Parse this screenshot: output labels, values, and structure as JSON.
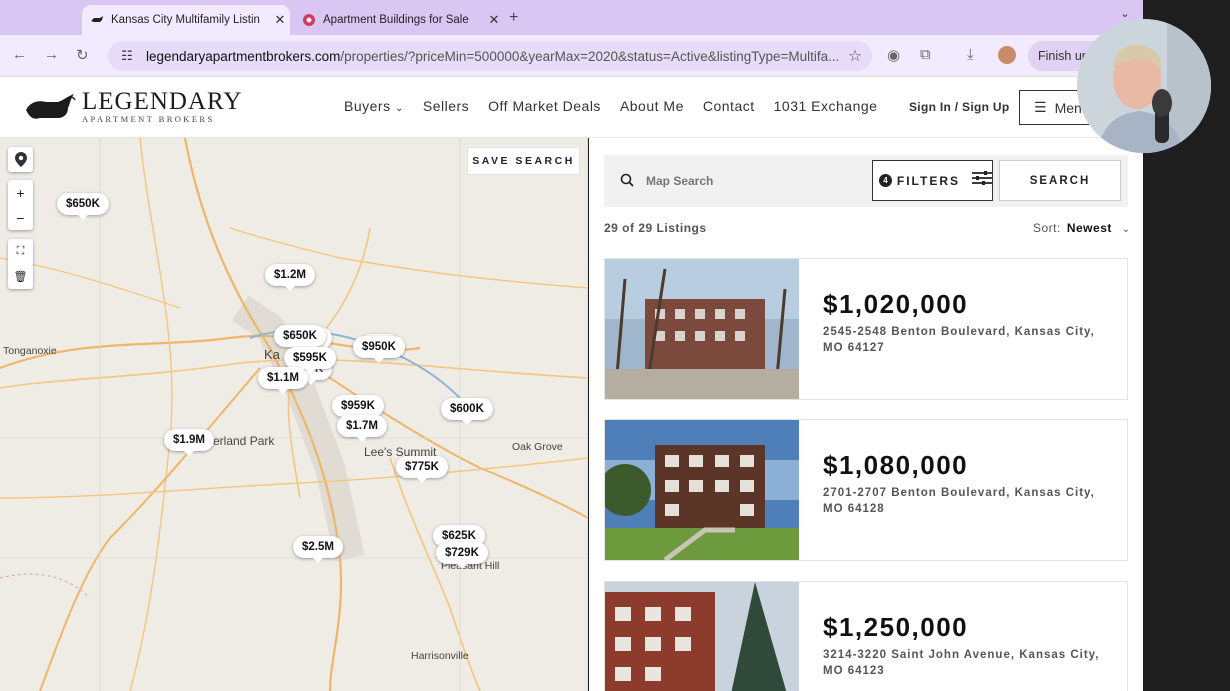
{
  "browser": {
    "tabs": [
      {
        "title": "Kansas City Multifamily Listin",
        "active": true
      },
      {
        "title": "Apartment Buildings for Sale",
        "active": false
      }
    ],
    "url_host": "legendaryapartmentbrokers.com",
    "url_path": "/properties/?priceMin=500000&yearMax=2020&status=Active&listingType=Multifa...",
    "profile_button": "Finish up"
  },
  "site": {
    "logo_name": "LEGENDARY",
    "logo_sub": "APARTMENT BROKERS",
    "nav": [
      "Buyers",
      "Sellers",
      "Off Market Deals",
      "About Me",
      "Contact",
      "1031 Exchange"
    ],
    "sign_in": "Sign In",
    "sign_sep": "/",
    "sign_up": "Sign Up",
    "menu_label": "Menu"
  },
  "map": {
    "save_search": "SAVE SEARCH",
    "controls": [
      "pin",
      "zoom-in",
      "zoom-out",
      "draw",
      "delete"
    ],
    "place_labels": [
      "Tonganoxie",
      "Oak Grove",
      "Lee's Summit",
      "Pleasant Hill",
      "Harrisonville",
      "erland Park",
      "Ka"
    ],
    "pins": [
      "$650K",
      "$1.2M",
      "$650K",
      "$950K",
      "$595K",
      "$1.1M",
      "$959K",
      "$600K",
      "$1.7M",
      "$1.9M",
      "$775K",
      "$625K",
      "$729K",
      "$2.5M"
    ]
  },
  "search": {
    "placeholder": "Map Search",
    "filters_label": "FILTERS",
    "filters_count": "4",
    "search_button": "SEARCH",
    "results_count": "29 of 29 Listings",
    "sort_label": "Sort:",
    "sort_value": "Newest"
  },
  "listings": [
    {
      "price": "$1,020,000",
      "address": "2545-2548 Benton Boulevard, Kansas City, MO 64127"
    },
    {
      "price": "$1,080,000",
      "address": "2701-2707 Benton Boulevard, Kansas City, MO 64128"
    },
    {
      "price": "$1,250,000",
      "address": "3214-3220 Saint John Avenue, Kansas City, MO 64123"
    }
  ]
}
